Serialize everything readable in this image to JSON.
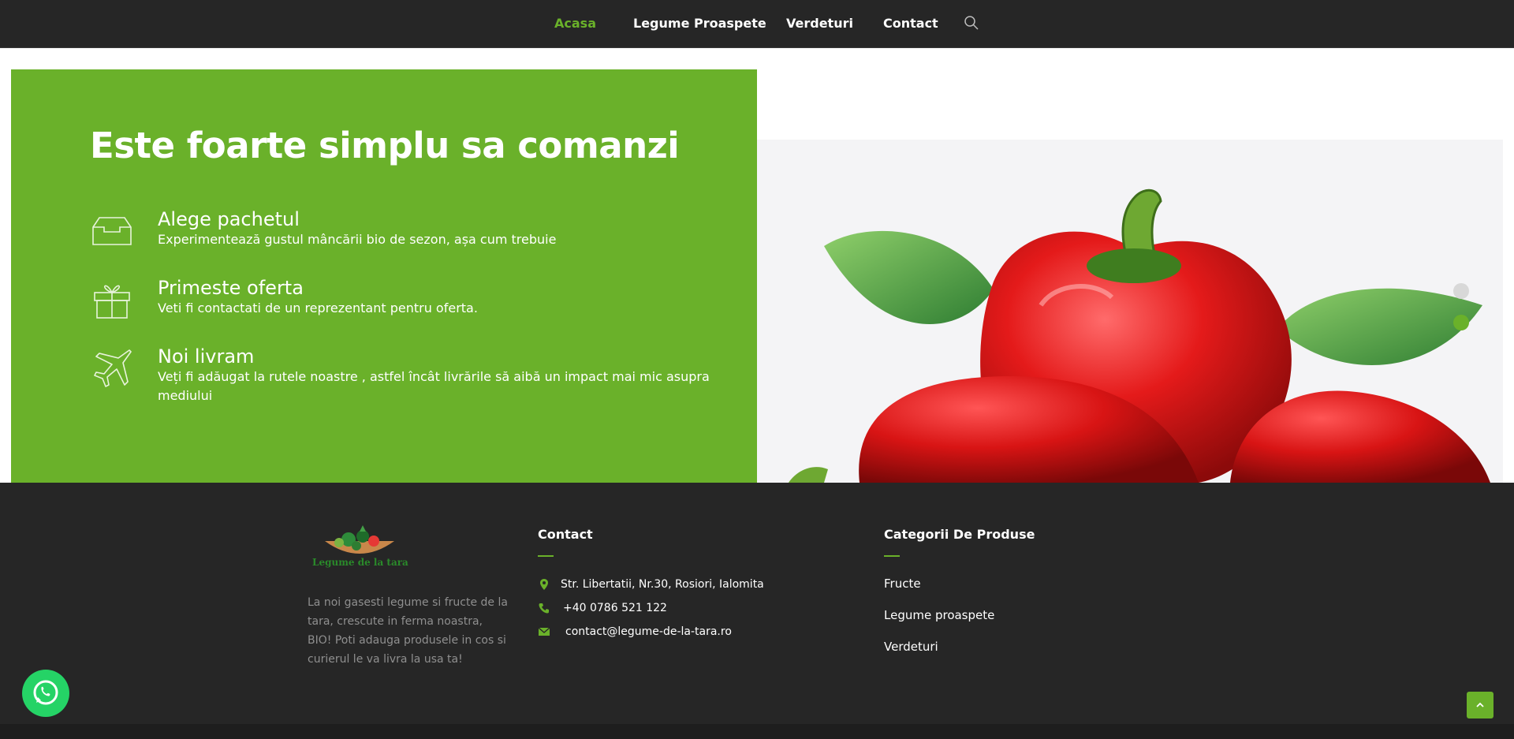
{
  "nav": {
    "items": [
      "Acasa",
      "Legume Proaspete",
      "Verdeturi",
      "Contact"
    ]
  },
  "hero": {
    "title": "Este foarte simplu sa comanzi",
    "steps": [
      {
        "title": "Alege pachetul",
        "desc": "Experimentează gustul mâncării bio de sezon, așa cum trebuie",
        "icon": "box-icon"
      },
      {
        "title": "Primeste oferta",
        "desc": "Veti fi contactati de un reprezentant pentru oferta.",
        "icon": "gift-icon"
      },
      {
        "title": "Noi livram",
        "desc": "Veți fi adăugat la rutele noastre , astfel încât livrările să aibă un impact mai mic asupra mediului",
        "icon": "airplane-icon"
      }
    ],
    "slider": {
      "count": 2,
      "active_index": 1
    }
  },
  "footer": {
    "logo_text": "Legume de la tara",
    "about": "La noi gasesti legume si fructe de la tara, crescute in ferma noastra, BIO! Poti adauga produsele in cos si curierul le va livra la usa ta!",
    "contact": {
      "title": "Contact",
      "address": "Str. Libertatii, Nr.30, Rosiori, Ialomita",
      "phone": "+40 0786 521 122",
      "email": "contact@legume-de-la-tara.ro"
    },
    "categories": {
      "title": "Categorii De Produse",
      "items": [
        "Fructe",
        "Legume proaspete",
        "Verdeturi"
      ]
    }
  },
  "colors": {
    "accent": "#6ab12a",
    "dark": "#262626",
    "whatsapp": "#25d366"
  }
}
